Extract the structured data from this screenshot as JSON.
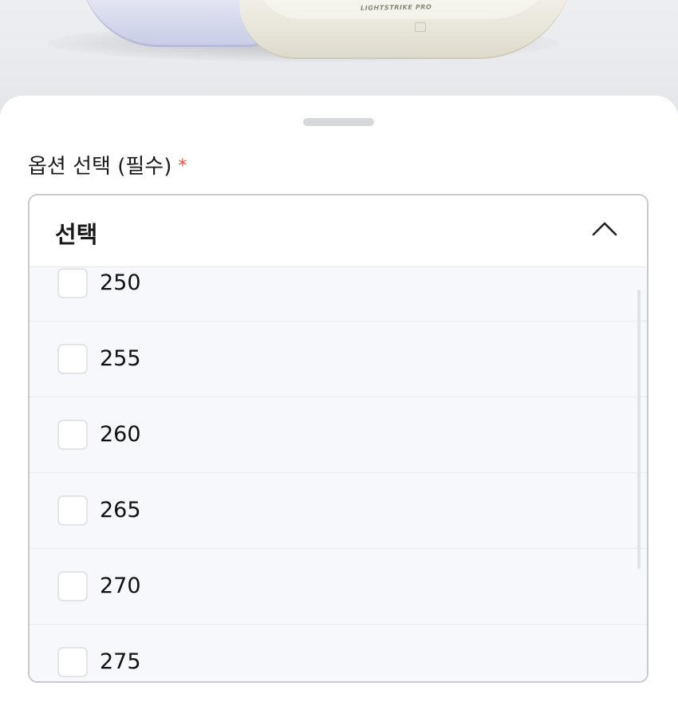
{
  "product": {
    "brand_print": "LIGHTSTRIKE PRO"
  },
  "option_section": {
    "label": "옵션 선택 (필수)",
    "required_mark": "*"
  },
  "dropdown": {
    "selected_value": "선택",
    "expanded": true,
    "chevron_icon": "chevron-up-icon",
    "options": [
      {
        "label": "250",
        "checked": false
      },
      {
        "label": "255",
        "checked": false
      },
      {
        "label": "260",
        "checked": false
      },
      {
        "label": "265",
        "checked": false
      },
      {
        "label": "270",
        "checked": false
      },
      {
        "label": "275",
        "checked": false
      }
    ]
  },
  "colors": {
    "required_mark": "#e5533d",
    "list_background": "#f6f8fb",
    "border": "#c9cacd"
  }
}
